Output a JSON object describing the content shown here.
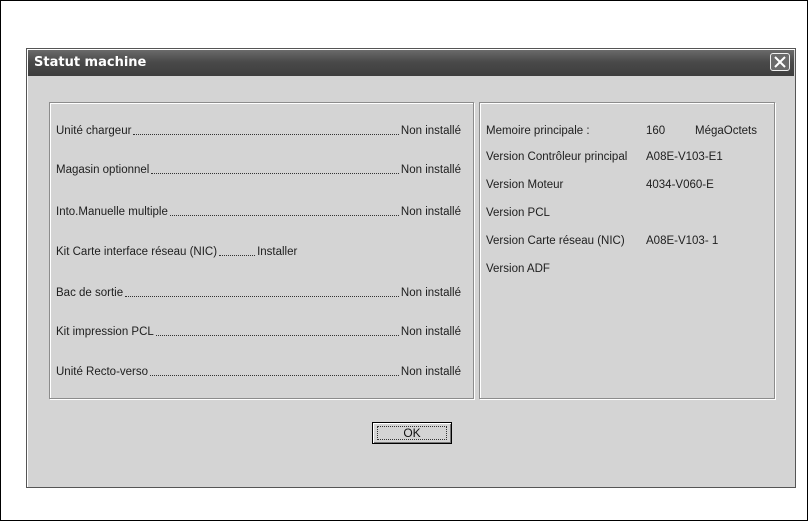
{
  "dialog": {
    "title": "Statut machine",
    "ok_label": "OK"
  },
  "options": [
    {
      "label": "Unité chargeur",
      "value": "Non installé"
    },
    {
      "label": "Magasin optionnel",
      "value": "Non installé"
    },
    {
      "label": "Into.Manuelle multiple",
      "value": "Non installé"
    },
    {
      "label": "Kit Carte interface réseau (NIC)",
      "value": "Installer"
    },
    {
      "label": "Bac de sortie",
      "value": "Non installé"
    },
    {
      "label": "Kit impression PCL",
      "value": "Non installé"
    },
    {
      "label": "Unité Recto-verso",
      "value": "Non installé"
    }
  ],
  "info": {
    "memory_label": "Memoire principale :",
    "memory_value": "160",
    "memory_unit": "MégaOctets",
    "versions": [
      {
        "label": "Version Contrôleur principal",
        "value": "A08E-V103-E1"
      },
      {
        "label": "Version Moteur",
        "value": "4034-V060-E"
      },
      {
        "label": "Version PCL",
        "value": ""
      },
      {
        "label": "Version Carte réseau (NIC)",
        "value": "A08E-V103- 1"
      },
      {
        "label": "Version ADF",
        "value": ""
      }
    ]
  }
}
